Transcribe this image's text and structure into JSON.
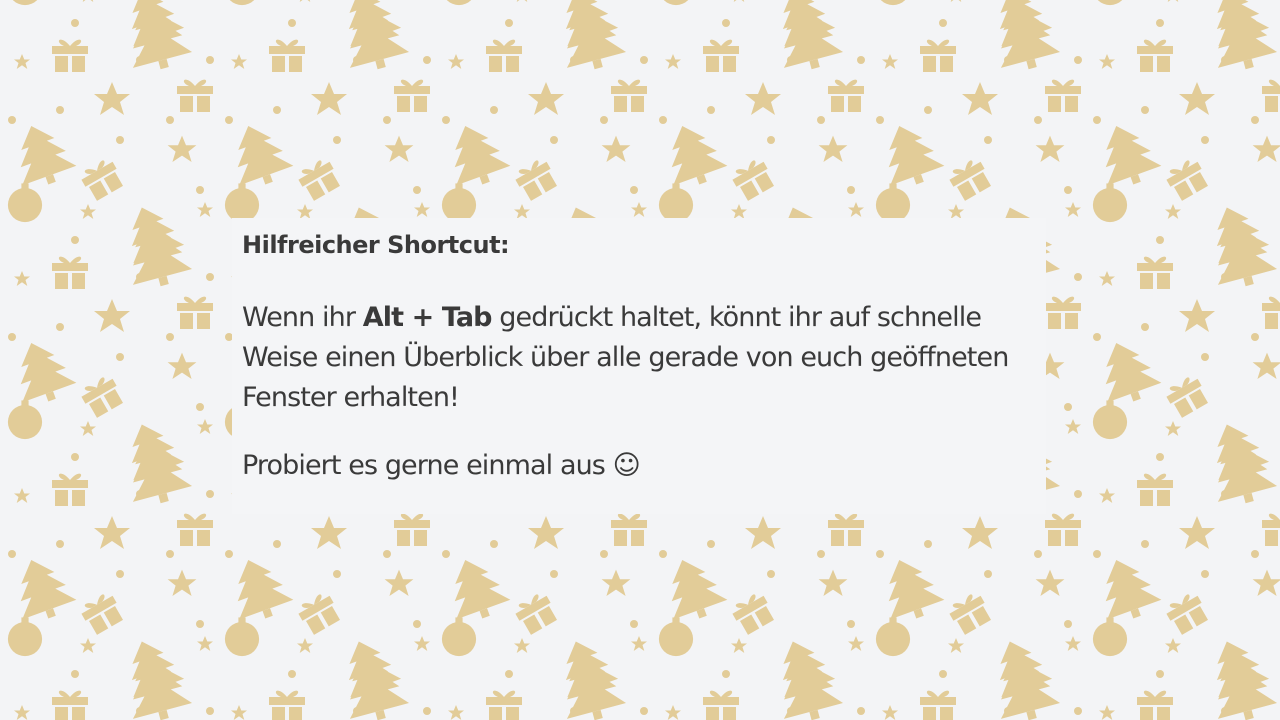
{
  "slide": {
    "background_color": "#f3f4f6",
    "pattern_color": "#e2cc98",
    "pattern_icons": [
      "christmas-tree-icon",
      "gift-icon",
      "star-icon",
      "ornament-ball-icon",
      "dot-icon"
    ],
    "heading": "Hilfreicher Shortcut:",
    "paragraph1": {
      "before": "Wenn ihr ",
      "bold": "Alt + Tab",
      "after": " gedrückt haltet, könnt ihr auf schnelle Weise einen Überblick über alle gerade von euch geöffneten Fenster erhalten!"
    },
    "paragraph2": {
      "text": "Probiert es gerne einmal aus",
      "emoji": "☺"
    }
  }
}
